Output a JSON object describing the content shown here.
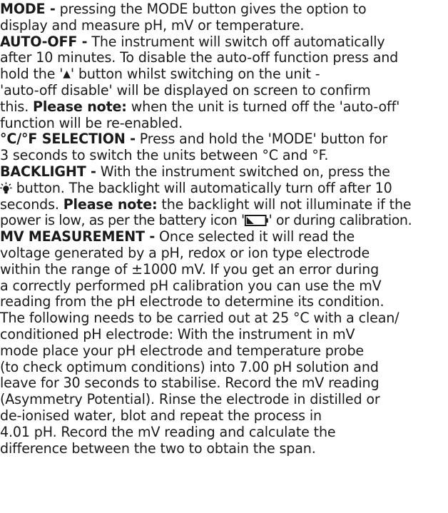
{
  "paragraphs": {
    "mode": {
      "heading": "MODE -",
      "l1": " pressing the MODE button gives the option to",
      "l2": "display and measure pH, mV or temperature."
    },
    "auto_off": {
      "heading": "AUTO-OFF -",
      "l1": " The instrument will switch off automatically",
      "l2": "after 10 minutes. To disable the auto-off function press and",
      "l3_a": "hold the '",
      "l3_glyph": "▲",
      "l3_b": "' button whilst switching on the unit -",
      "l4": "'auto-off disable' will be displayed on screen to confirm",
      "l5_a": "this. ",
      "l5_note": "Please note:",
      "l5_b": " when the unit is turned off the 'auto-off'",
      "l6": "function will be re-enabled."
    },
    "unit_selection": {
      "heading": "°C/°F SELECTION -",
      "l1": " Press and hold the 'MODE' button for",
      "l2": "3 seconds to switch the units between °C and °F."
    },
    "backlight": {
      "heading": "BACKLIGHT -",
      "l1": " With the instrument switched on, press the",
      "bulb_icon": "lightbulb-icon",
      "l2": " button. The backlight will automatically turn off after 10",
      "l3_a": "seconds. ",
      "l3_note": "Please note:",
      "l3_b": " the  backlight will not illuminate if the",
      "l4_a": "power is low, as per the battery icon '",
      "battery_icon": "battery-low-icon",
      "l4_b": "' or during calibration."
    },
    "mv_measurement": {
      "heading": "MV MEASUREMENT -",
      "l1": " Once selected it will read the",
      "lines": [
        "voltage generated by a pH, redox or ion type electrode",
        "within the range of ±1000 mV. If you get an error during",
        "a correctly performed pH calibration you can use the mV",
        "reading from the pH  electrode to determine its condition.",
        "The following needs to be carried out at 25 °C with a clean/",
        "conditioned pH electrode: With the instrument in mV",
        "mode place your pH electrode and temperature probe",
        "(to check optimum conditions) into 7.00 pH solution and",
        "leave for 30 seconds to stabilise.  Record the mV reading",
        "(Asymmetry Potential).  Rinse the electrode in distilled or",
        "de-ionised water, blot and repeat the process in",
        "4.01 pH.  Record the mV reading and calculate the",
        "difference between the two to obtain the span."
      ]
    }
  },
  "colors": {
    "text": "#1a1a1a",
    "background": "#ffffff"
  }
}
